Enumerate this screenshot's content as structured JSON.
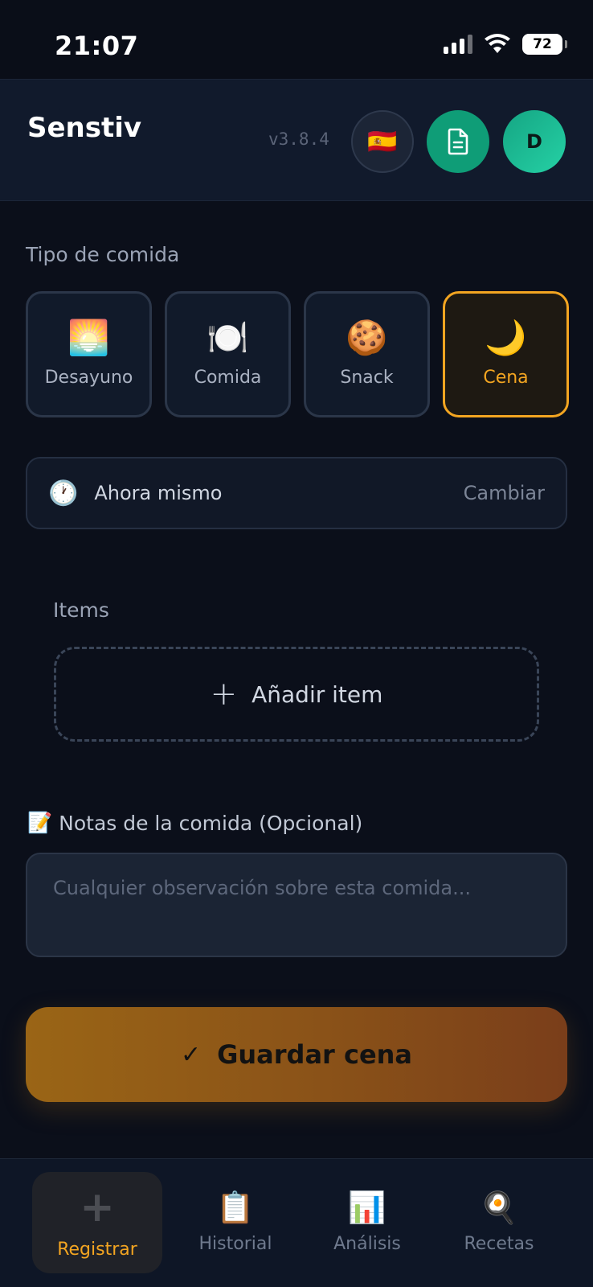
{
  "status_bar": {
    "time": "21:07",
    "battery": "72"
  },
  "header": {
    "title": "Senstiv",
    "version": "v3.8.4",
    "language_flag": "🇪🇸",
    "avatar_initial": "D"
  },
  "meal_type": {
    "label": "Tipo de comida",
    "options": [
      {
        "emoji": "🌅",
        "label": "Desayuno",
        "selected": false
      },
      {
        "emoji": "🍽️",
        "label": "Comida",
        "selected": false
      },
      {
        "emoji": "🍪",
        "label": "Snack",
        "selected": false
      },
      {
        "emoji": "🌙",
        "label": "Cena",
        "selected": true
      }
    ]
  },
  "time": {
    "icon": "🕐",
    "value": "Ahora mismo",
    "change_label": "Cambiar"
  },
  "items": {
    "label": "Items",
    "add_label": "Añadir item"
  },
  "notes": {
    "icon": "📝",
    "label": "Notas de la comida (Opcional)",
    "placeholder": "Cualquier observación sobre esta comida..."
  },
  "save": {
    "label": "Guardar cena"
  },
  "tabs": [
    {
      "icon": "+",
      "label": "Registrar",
      "active": true
    },
    {
      "icon": "📋",
      "label": "Historial",
      "active": false
    },
    {
      "icon": "📊",
      "label": "Análisis",
      "active": false
    },
    {
      "icon": "🍳",
      "label": "Recetas",
      "active": false
    }
  ],
  "colors": {
    "accent": "#f3a521",
    "background": "#0b0f1a",
    "header": "#111a2c",
    "green": "#0f9d77"
  }
}
